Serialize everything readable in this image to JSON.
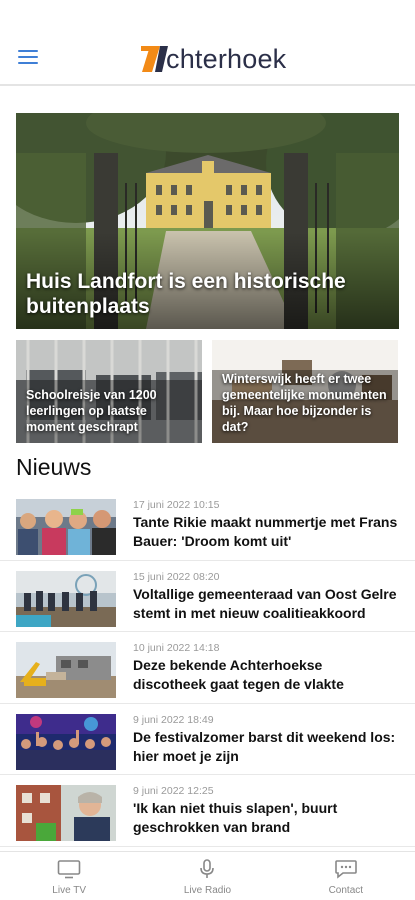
{
  "header": {
    "logo_text": "chterhoek",
    "brand_color": "#f28a16",
    "menu_icon": "hamburger-menu-icon"
  },
  "featured": {
    "title": "Huis Landfort is een historische buitenplaats"
  },
  "highlights": [
    {
      "title": "Schoolreisje van 1200 leerlingen op laatste moment geschrapt"
    },
    {
      "title": "Winterswijk heeft er twee gemeentelijke monumenten bij. Maar hoe bijzonder is dat?"
    }
  ],
  "news": {
    "section_title": "Nieuws",
    "items": [
      {
        "date": "17 juni 2022 10:15",
        "title": "Tante Rikie maakt nummertje met Frans Bauer: 'Droom komt uit'"
      },
      {
        "date": "15 juni 2022 08:20",
        "title": "Voltallige gemeenteraad van Oost Gelre stemt in met nieuw coalitieakkoord"
      },
      {
        "date": "10 juni 2022 14:18",
        "title": "Deze bekende Achterhoekse discotheek gaat tegen de vlakte"
      },
      {
        "date": "9 juni 2022 18:49",
        "title": "De festivalzomer barst dit weekend los: hier moet je zijn"
      },
      {
        "date": "9 juni 2022 12:25",
        "title": "'Ik kan niet thuis slapen', buurt geschrokken van brand"
      }
    ]
  },
  "bottom_nav": [
    {
      "label": "Live TV",
      "icon": "tv-icon"
    },
    {
      "label": "Live Radio",
      "icon": "microphone-icon"
    },
    {
      "label": "Contact",
      "icon": "chat-bubble-icon"
    }
  ]
}
